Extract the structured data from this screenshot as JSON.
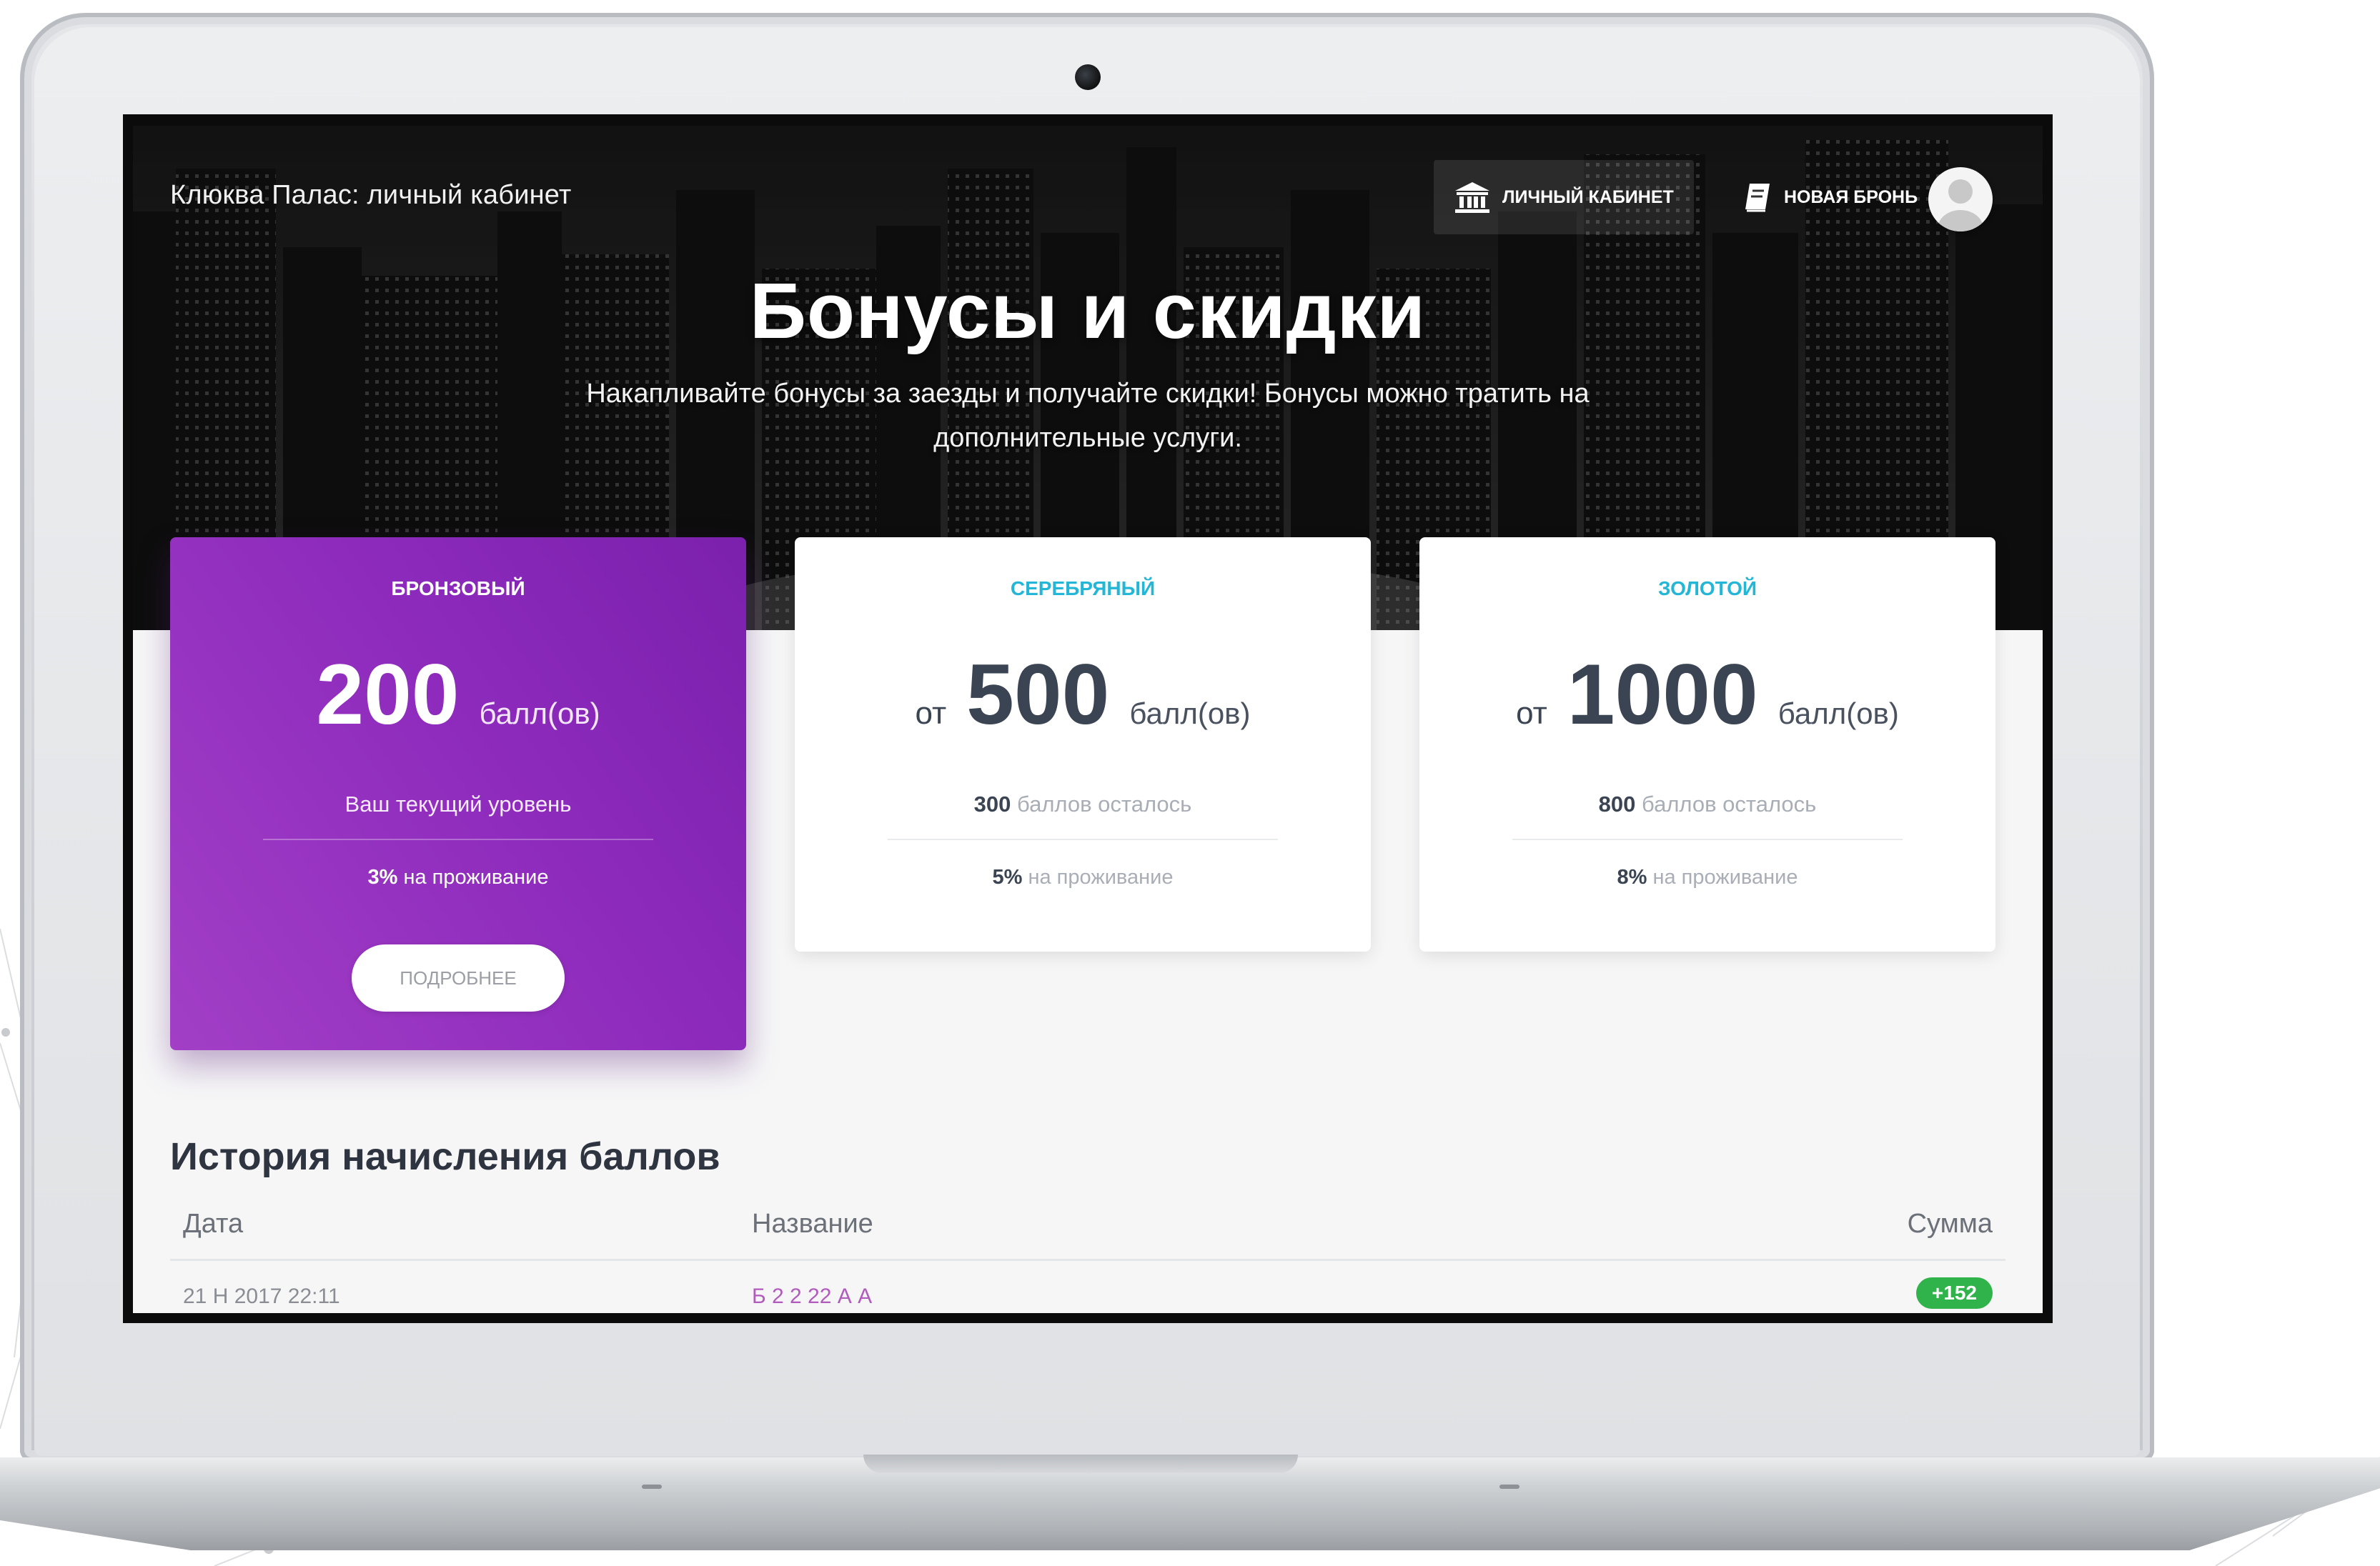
{
  "app": {
    "brand": "Клюква Палас: личный кабинет"
  },
  "nav": {
    "cabinet_label": "ЛИЧНЫЙ КАБИНЕТ",
    "booking_label": "НОВАЯ БРОНЬ"
  },
  "hero": {
    "title": "Бонусы и скидки",
    "subtitle": "Накапливайте бонусы за заезды и получайте скидки! Бонусы можно тратить на дополнительные услуги."
  },
  "tiers": [
    {
      "name": "БРОНЗОВЫЙ",
      "prefix": "",
      "points": "200",
      "unit": "балл(ов)",
      "line1": "Ваш текущий уровень",
      "discount": "3%",
      "discount_text": "на проживание",
      "button": "ПОДРОБНЕЕ"
    },
    {
      "name": "СЕРЕБРЯНЫЙ",
      "prefix": "от",
      "points": "500",
      "unit": "балл(ов)",
      "remaining": "300",
      "remaining_text": "баллов осталось",
      "discount": "5%",
      "discount_text": "на проживание"
    },
    {
      "name": "ЗОЛОТОЙ",
      "prefix": "от",
      "points": "1000",
      "unit": "балл(ов)",
      "remaining": "800",
      "remaining_text": "баллов осталось",
      "discount": "8%",
      "discount_text": "на проживание"
    }
  ],
  "history": {
    "title": "История начисления баллов",
    "columns": [
      "Дата",
      "Название",
      "Сумма"
    ],
    "rows": [
      {
        "date": "21 Н 2017 22:11",
        "name": "Б 2 2 22 А А",
        "sum": "+152"
      }
    ]
  },
  "colors": {
    "bronze_gradient_start": "#7b20ad",
    "bronze_gradient_end": "#a23fc6",
    "tier_accent": "#24b6d6",
    "sum_badge": "#2fb34a",
    "title_text": "#2f3540"
  },
  "icons": {
    "cabinet": "bank-icon",
    "booking": "book-icon",
    "avatar": "user-avatar-icon"
  }
}
